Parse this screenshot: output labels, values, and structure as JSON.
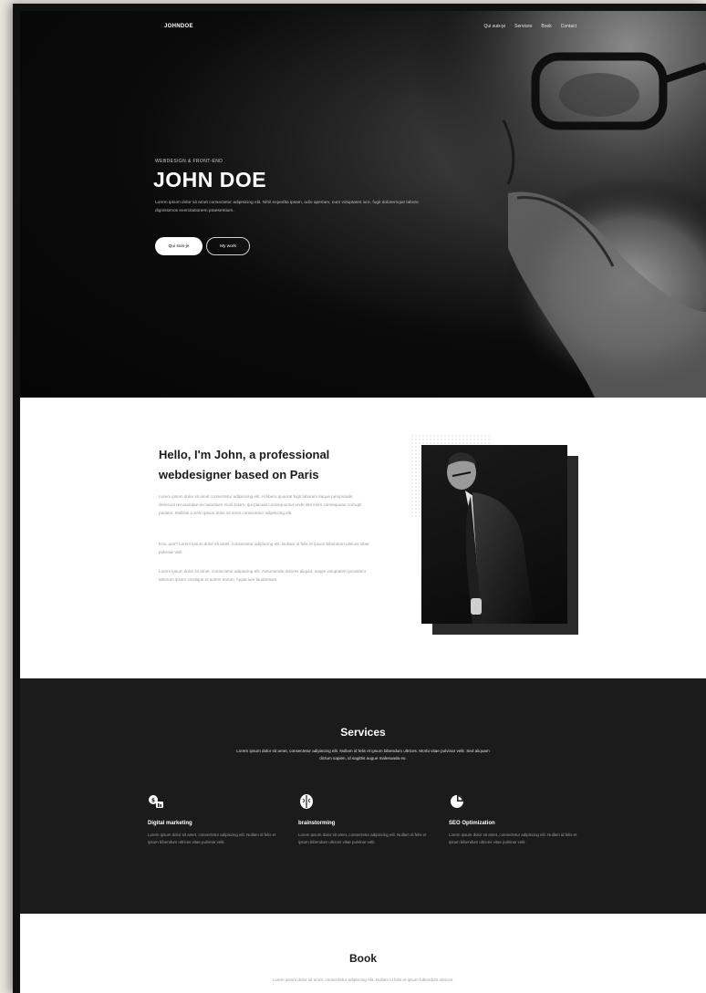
{
  "nav": {
    "logo": "JOHNDOE",
    "links": [
      "Qui suis-je",
      "Services",
      "Book",
      "Contact"
    ]
  },
  "hero": {
    "kicker": "WEBDESIGN & FRONT-END",
    "title": "JOHN DOE",
    "description": "Lorem ipsum dolor sit amet consectetur adipisicing elit. Nihil expedita ipsam, odio aperiam, eum voluptates iure, fugit doloremque labore dignissimos exercitationem praesentium.",
    "primary_button": "Qui suis-je",
    "secondary_button": "My work"
  },
  "about": {
    "title": "Hello, I'm John, a professional webdesigner based on Paris",
    "paragraphs": [
      "Lorem ipsum dolor sit amet consectetur adipisicing elit. At libero quaerat fugit laborum itaque perspiciatis, deserunt recusandae accusantium modi totam, qui placeat consequuntur unde iste enim consequatur corrupti pariatur. Mollitia! Lorem ipsum dolor sit amet consectetur adipisicing elit.",
      "Eos, quo? Lorem ipsum dolor sit amet, consectetur adipiscing elit. Nullam id felis et ipsum bibendum ultrices vitae pulvinar velit.",
      "Lorem ipsum dolor sit amet, consectetur adipiscing elit. Assumenda dolores aliquid, magni voluptatem provident laborum ipsum similique et autem earum, fugiat iure laudantium."
    ]
  },
  "services": {
    "title": "Services",
    "subtitle": "Lorem ipsum dolor sit amet, consectetur adipiscing elit. Nullam id felis et ipsum bibendum ultrices. Morbi vitae pulvinar velit. Sed aliquam dictum sapien, id sagittis augue malesuada eu.",
    "items": [
      {
        "icon": "marketing-icon",
        "title": "Digital marketing",
        "text": "Lorem ipsum dolor sit amet, consectetur adipiscing elit. Nullam id felis et ipsum bibendum ultrices vitae pulvinar velit."
      },
      {
        "icon": "brain-icon",
        "title": "brainstorming",
        "text": "Lorem ipsum dolor sit amet, consectetur adipiscing elit. Nullam id felis et ipsum bibendum ultrices vitae pulvinar velit."
      },
      {
        "icon": "pie-chart-icon",
        "title": "SEO Optimization",
        "text": "Lorem ipsum dolor sit amet, consectetur adipiscing elit. Nullam id felis et ipsum bibendum ultrices vitae pulvinar velit."
      }
    ]
  },
  "book": {
    "title": "Book",
    "subtitle": "Lorem ipsum dolor sit amet, consectetur adipiscing elit. Nullam id felis et ipsum bibendum ultrices."
  },
  "colors": {
    "hero_bg": "#050505",
    "services_bg": "#1b1b1b",
    "accent": "#ffffff"
  }
}
